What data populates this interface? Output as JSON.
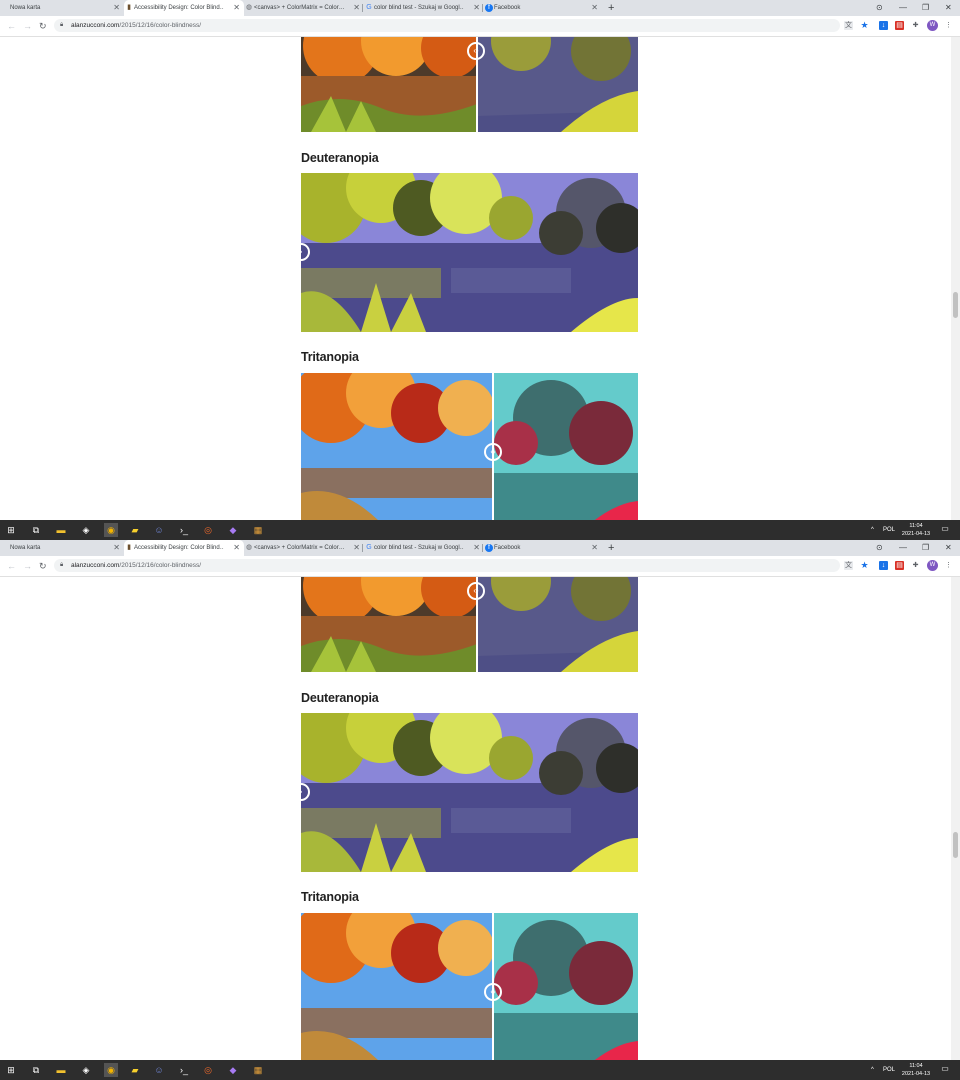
{
  "tabs": [
    {
      "title": "Nowa karta",
      "favicon": "none",
      "active": false
    },
    {
      "title": "Accessibility Design: Color Blind…",
      "favicon": "page-icon",
      "active": true
    },
    {
      "title": "<canvas> + ColorMatrix = Color…",
      "favicon": "globe-icon",
      "active": false
    },
    {
      "title": "color blind test - Szukaj w Googl…",
      "favicon": "google-icon",
      "active": false
    },
    {
      "title": "Facebook",
      "favicon": "facebook-icon",
      "active": false
    }
  ],
  "address": {
    "host": "alanzucconi.com",
    "path": "/2015/12/16/color-blindness/"
  },
  "sections": {
    "deuteranopia": "Deuteranopia",
    "tritanopia": "Tritanopia"
  },
  "taskbar": {
    "language": "POL",
    "time": "11:04",
    "date": "2021-04-13",
    "apps": [
      "windows-start-icon",
      "task-view-icon",
      "file-explorer-icon",
      "vscode-icon",
      "chrome-icon",
      "sticky-notes-icon",
      "discord-icon",
      "terminal-icon",
      "origin-icon",
      "visual-studio-icon",
      "paint-icon"
    ]
  },
  "colors": {
    "tab_strip": "#dee1e6",
    "taskbar": "#2d2d2d",
    "link_blue": "#1a73e8"
  }
}
